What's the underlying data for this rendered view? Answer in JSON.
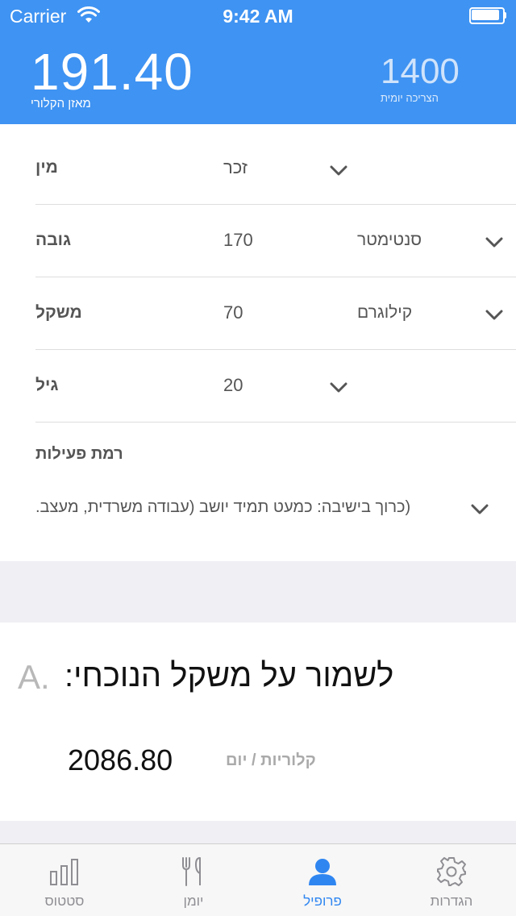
{
  "status_bar": {
    "carrier": "Carrier",
    "time": "9:42 AM"
  },
  "header": {
    "balance_value": "191.40",
    "balance_label": "מאזן הקלורי",
    "daily_value": "1400",
    "daily_label": "הצריכה יומית",
    "accent_color": "#3f93f2"
  },
  "form": {
    "gender": {
      "label": "מין",
      "value": "זכר"
    },
    "height": {
      "label": "גובה",
      "value": "170",
      "unit": "סנטימטר"
    },
    "weight": {
      "label": "משקל",
      "value": "70",
      "unit": "קילוגרם"
    },
    "age": {
      "label": "גיל",
      "value": "20"
    },
    "activity": {
      "label": "רמת פעילות",
      "value": "(כרוך בישיבה: כמעט תמיד יושב (עבודה משרדית, מעצב."
    }
  },
  "result": {
    "letter": "A.",
    "goal": "לשמור על משקל הנוכחי:",
    "calories_value": "2086.80",
    "calories_unit": "קלוריות / יום"
  },
  "tabbar": {
    "tabs": [
      {
        "label": "סטטוס",
        "icon": "bar-chart-icon"
      },
      {
        "label": "יומן",
        "icon": "fork-knife-icon"
      },
      {
        "label": "פרופיל",
        "icon": "person-icon",
        "active": true
      },
      {
        "label": "הגדרות",
        "icon": "gear-icon"
      }
    ],
    "active_color": "#2f86f1"
  }
}
